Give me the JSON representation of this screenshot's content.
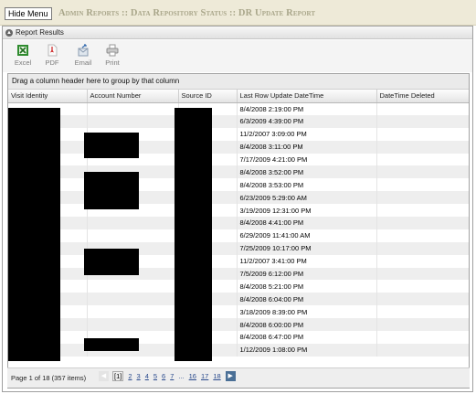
{
  "header": {
    "hide_menu_label": "Hide Menu",
    "breadcrumb": "Admin Reports :: Data Repository Status :: DR Update Report"
  },
  "panel": {
    "title": "Report Results"
  },
  "toolbar": {
    "items": [
      {
        "label": "Excel",
        "icon": "excel-icon"
      },
      {
        "label": "PDF",
        "icon": "pdf-icon"
      },
      {
        "label": "Email",
        "icon": "email-icon"
      },
      {
        "label": "Print",
        "icon": "print-icon"
      }
    ]
  },
  "grid": {
    "group_hint": "Drag a column header here to group by that column",
    "columns": [
      "Visit Identity",
      "Account Number",
      "Source ID",
      "Last Row Update DateTime",
      "DateTime Deleted"
    ],
    "rows": [
      {
        "last_update": "8/4/2008 2:19:00 PM",
        "deleted": ""
      },
      {
        "last_update": "6/3/2009 4:39:00 PM",
        "deleted": ""
      },
      {
        "last_update": "11/2/2007 3:09:00 PM",
        "deleted": ""
      },
      {
        "last_update": "8/4/2008 3:11:00 PM",
        "deleted": ""
      },
      {
        "last_update": "7/17/2009 4:21:00 PM",
        "deleted": ""
      },
      {
        "last_update": "8/4/2008 3:52:00 PM",
        "deleted": ""
      },
      {
        "last_update": "8/4/2008 3:53:00 PM",
        "deleted": ""
      },
      {
        "last_update": "6/23/2009 5:29:00 AM",
        "deleted": ""
      },
      {
        "last_update": "3/19/2009 12:31:00 PM",
        "deleted": ""
      },
      {
        "last_update": "8/4/2008 4:41:00 PM",
        "deleted": ""
      },
      {
        "last_update": "6/29/2009 11:41:00 AM",
        "deleted": ""
      },
      {
        "last_update": "7/25/2009 10:17:00 PM",
        "deleted": ""
      },
      {
        "last_update": "11/2/2007 3:41:00 PM",
        "deleted": ""
      },
      {
        "last_update": "7/5/2009 6:12:00 PM",
        "deleted": ""
      },
      {
        "last_update": "8/4/2008 5:21:00 PM",
        "deleted": ""
      },
      {
        "last_update": "8/4/2008 6:04:00 PM",
        "deleted": ""
      },
      {
        "last_update": "3/18/2009 8:39:00 PM",
        "deleted": ""
      },
      {
        "last_update": "8/4/2008 6:00:00 PM",
        "deleted": ""
      },
      {
        "last_update": "8/4/2008 6:47:00 PM",
        "deleted": ""
      },
      {
        "last_update": "1/12/2009 1:08:00 PM",
        "deleted": ""
      }
    ]
  },
  "pager": {
    "info": "Page 1 of 18 (357 items)",
    "pages": [
      "[1]",
      "2",
      "3",
      "4",
      "5",
      "6",
      "7",
      "...",
      "16",
      "17",
      "18"
    ],
    "prev_icon": "chevron-left-icon",
    "next_icon": "chevron-right-icon"
  }
}
